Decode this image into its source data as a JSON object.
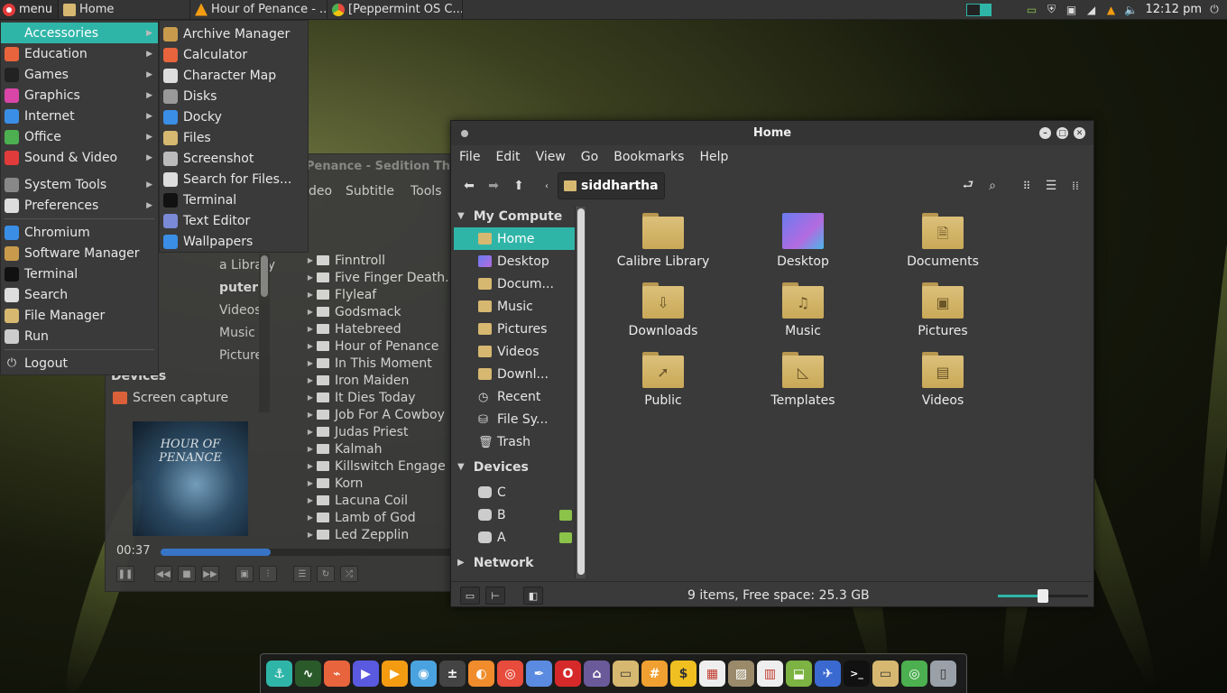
{
  "panel": {
    "menu_label": "menu",
    "tasks": [
      {
        "label": "Home",
        "color": "#d6b870"
      },
      {
        "label": "Hour of Penance - ...",
        "color": "#f39c12"
      },
      {
        "label": "[Peppermint OS C...",
        "color": "#4caf50"
      }
    ],
    "clock": "12:12 pm"
  },
  "menu": {
    "categories": [
      {
        "label": "Accessories",
        "color": "#2fb5a8",
        "selected": true
      },
      {
        "label": "Education",
        "color": "#e8643c"
      },
      {
        "label": "Games",
        "color": "#222222"
      },
      {
        "label": "Graphics",
        "color": "#d946a8"
      },
      {
        "label": "Internet",
        "color": "#3a8ee6"
      },
      {
        "label": "Office",
        "color": "#4caf50"
      },
      {
        "label": "Sound & Video",
        "color": "#e23b3b"
      },
      {
        "label": "System Tools",
        "color": "#888888"
      },
      {
        "label": "Preferences",
        "color": "#dddddd"
      }
    ],
    "favorites": [
      {
        "label": "Chromium",
        "color": "#3a8ee6"
      },
      {
        "label": "Software Manager",
        "color": "#c89b4c"
      },
      {
        "label": "Terminal",
        "color": "#111111"
      },
      {
        "label": "Search",
        "color": "#dddddd"
      },
      {
        "label": "File Manager",
        "color": "#d6b870"
      },
      {
        "label": "Run",
        "color": "#cccccc"
      }
    ],
    "logout": "Logout"
  },
  "submenu": {
    "items": [
      {
        "label": "Archive Manager",
        "color": "#c89b4c"
      },
      {
        "label": "Calculator",
        "color": "#e8643c"
      },
      {
        "label": "Character Map",
        "color": "#dddddd"
      },
      {
        "label": "Disks",
        "color": "#999999"
      },
      {
        "label": "Docky",
        "color": "#3a8ee6"
      },
      {
        "label": "Files",
        "color": "#d6b870"
      },
      {
        "label": "Screenshot",
        "color": "#bbbbbb"
      },
      {
        "label": "Search for Files...",
        "color": "#dddddd"
      },
      {
        "label": "Terminal",
        "color": "#111111"
      },
      {
        "label": "Text Editor",
        "color": "#7a8ad6"
      },
      {
        "label": "Wallpapers",
        "color": "#3a8ee6"
      }
    ]
  },
  "player": {
    "title": "Penance - Sedition Thro",
    "menus": [
      "deo",
      "Subtitle",
      "Tools"
    ],
    "sidebar": [
      "a Library",
      "puter",
      "Videos",
      "Music",
      "Pictures",
      "Devices",
      "Screen capture"
    ],
    "artists": [
      "Finntroll",
      "Five Finger Death...",
      "Flyleaf",
      "Godsmack",
      "Hatebreed",
      "Hour of Penance",
      "In This Moment",
      "Iron Maiden",
      "It Dies Today",
      "Job For A Cowboy",
      "Judas Priest",
      "Kalmah",
      "Killswitch Engage",
      "Korn",
      "Lacuna Coil",
      "Lamb of God",
      "Led Zepplin"
    ],
    "album_text": "HOUR OF PENANCE",
    "time": "00:37",
    "progress": 0.36
  },
  "fm": {
    "title": "Home",
    "menus": [
      "File",
      "Edit",
      "View",
      "Go",
      "Bookmarks",
      "Help"
    ],
    "breadcrumb": "siddhartha",
    "sections": {
      "my_computer": "My Compute",
      "devices": "Devices",
      "network": "Network"
    },
    "places": [
      {
        "label": "Home",
        "selected": true
      },
      {
        "label": "Desktop"
      },
      {
        "label": "Docum..."
      },
      {
        "label": "Music"
      },
      {
        "label": "Pictures"
      },
      {
        "label": "Videos"
      },
      {
        "label": "Downl..."
      },
      {
        "label": "Recent"
      },
      {
        "label": "File Sy..."
      },
      {
        "label": "Trash"
      }
    ],
    "devices": [
      "C",
      "B",
      "A"
    ],
    "files": [
      {
        "label": "Calibre Library",
        "emblem": ""
      },
      {
        "label": "Desktop",
        "emblem": "desktop"
      },
      {
        "label": "Documents",
        "emblem": "🗎"
      },
      {
        "label": "Downloads",
        "emblem": "⇩"
      },
      {
        "label": "Music",
        "emblem": "♫"
      },
      {
        "label": "Pictures",
        "emblem": "▣"
      },
      {
        "label": "Public",
        "emblem": "➚"
      },
      {
        "label": "Templates",
        "emblem": "◺"
      },
      {
        "label": "Videos",
        "emblem": "▤"
      }
    ],
    "status": "9 items, Free space: 25.3 GB",
    "zoom": 0.5
  },
  "dock": [
    {
      "name": "docky",
      "color": "#2fb5a8",
      "glyph": "⚓"
    },
    {
      "name": "system-monitor",
      "color": "#2a5a2a",
      "glyph": "∿"
    },
    {
      "name": "ice",
      "color": "#e8643c",
      "glyph": "⌁"
    },
    {
      "name": "media-player",
      "color": "#5a5ae0",
      "glyph": "▶"
    },
    {
      "name": "vlc",
      "color": "#f39c12",
      "glyph": "▶"
    },
    {
      "name": "screenshot",
      "color": "#4aa3df",
      "glyph": "◉"
    },
    {
      "name": "calculator",
      "color": "#444444",
      "glyph": "±"
    },
    {
      "name": "firefox",
      "color": "#f08c2c",
      "glyph": "◐"
    },
    {
      "name": "chromium",
      "color": "#e74c3c",
      "glyph": "◎"
    },
    {
      "name": "feather",
      "color": "#5b8be0",
      "glyph": "✒"
    },
    {
      "name": "opera",
      "color": "#d62a2a",
      "glyph": "O"
    },
    {
      "name": "app-house",
      "color": "#6a5a9a",
      "glyph": "⌂"
    },
    {
      "name": "files",
      "color": "#d6b870",
      "glyph": "▭"
    },
    {
      "name": "hexchat",
      "color": "#f0a030",
      "glyph": "#"
    },
    {
      "name": "money",
      "color": "#f0c020",
      "glyph": "$"
    },
    {
      "name": "calendar",
      "color": "#eeeeee",
      "glyph": "▦"
    },
    {
      "name": "drive",
      "color": "#9a8a6a",
      "glyph": "▨"
    },
    {
      "name": "reader",
      "color": "#eeeeee",
      "glyph": "▥"
    },
    {
      "name": "software",
      "color": "#7cb342",
      "glyph": "⬓"
    },
    {
      "name": "thunderbird",
      "color": "#3a6ad0",
      "glyph": "✈"
    },
    {
      "name": "terminal",
      "color": "#111111",
      "glyph": ">_"
    },
    {
      "name": "file-manager",
      "color": "#d6b870",
      "glyph": "▭"
    },
    {
      "name": "chrome",
      "color": "#4caf50",
      "glyph": "◎"
    },
    {
      "name": "trash",
      "color": "#9aa0a8",
      "glyph": "▯"
    }
  ]
}
